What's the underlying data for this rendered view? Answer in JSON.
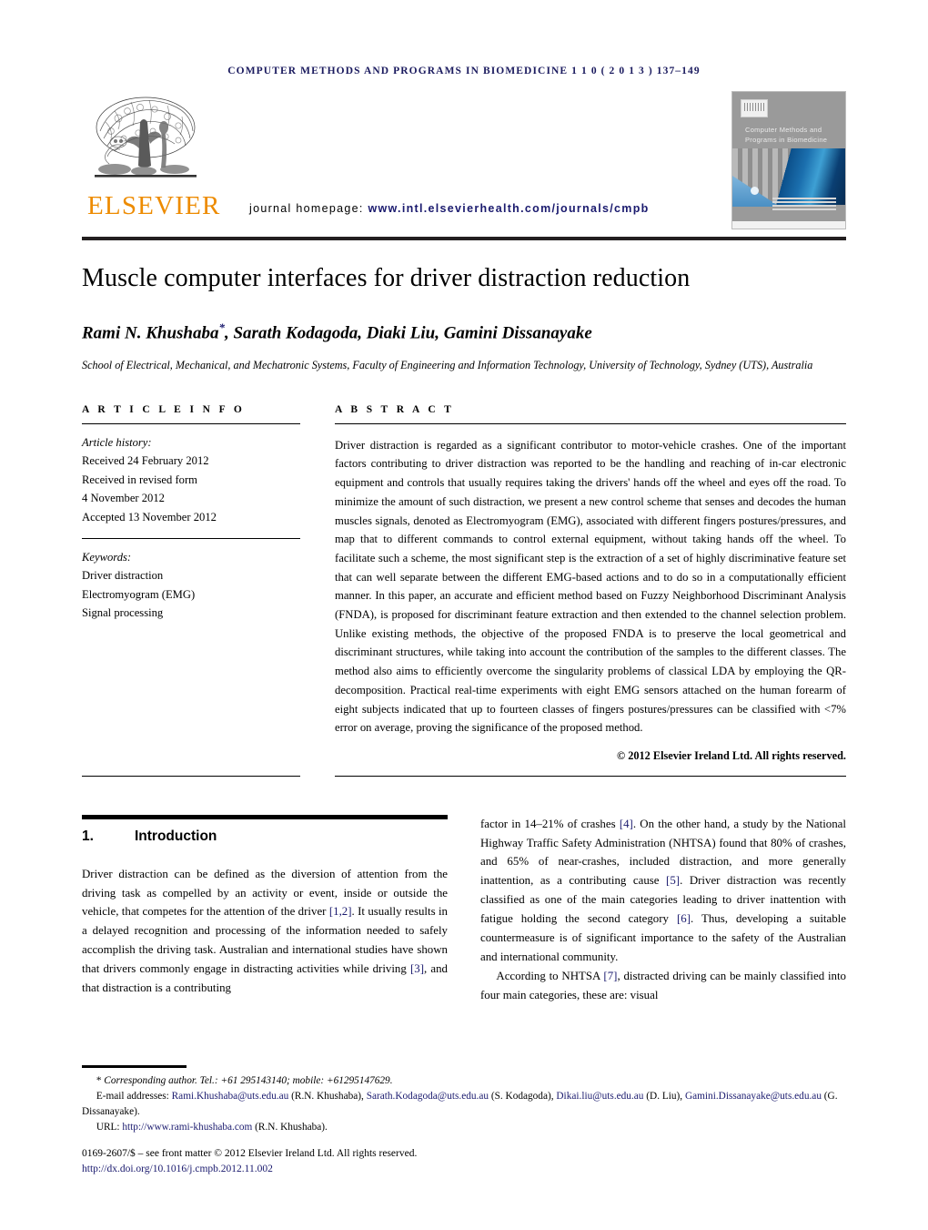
{
  "running_head": "Computer methods and programs in biomedicine 1 1 0 ( 2 0 1 3 ) 137–149",
  "masthead": {
    "publisher_wordmark": "ELSEVIER",
    "publisher_logo_icon": "elsevier-tree-icon",
    "homepage_label": "journal homepage:",
    "homepage_url": "www.intl.elsevierhealth.com/journals/cmpb",
    "cover": {
      "title": "Computer Methods and Programs in Biomedicine",
      "publisher_mark_icon": "elsevier-mark-icon"
    }
  },
  "title": "Muscle computer interfaces for driver distraction reduction",
  "authors": "Rami N. Khushaba, Sarath Kodagoda, Diaki Liu, Gamini Dissanayake",
  "author_marker": "*",
  "affiliation": "School of Electrical, Mechanical, and Mechatronic Systems, Faculty of Engineering and Information Technology, University of Technology, Sydney (UTS), Australia",
  "article_info": {
    "heading": "A R T I C L E   I N F O",
    "history_label": "Article history:",
    "history": [
      "Received 24 February 2012",
      "Received in revised form",
      "4 November 2012",
      "Accepted 13 November 2012"
    ],
    "keywords_label": "Keywords:",
    "keywords": [
      "Driver distraction",
      "Electromyogram (EMG)",
      "Signal processing"
    ]
  },
  "abstract": {
    "heading": "A B S T R A C T",
    "text": "Driver distraction is regarded as a significant contributor to motor-vehicle crashes. One of the important factors contributing to driver distraction was reported to be the handling and reaching of in-car electronic equipment and controls that usually requires taking the drivers' hands off the wheel and eyes off the road. To minimize the amount of such distraction, we present a new control scheme that senses and decodes the human muscles signals, denoted as Electromyogram (EMG), associated with different fingers postures/pressures, and map that to different commands to control external equipment, without taking hands off the wheel. To facilitate such a scheme, the most significant step is the extraction of a set of highly discriminative feature set that can well separate between the different EMG-based actions and to do so in a computationally efficient manner. In this paper, an accurate and efficient method based on Fuzzy Neighborhood Discriminant Analysis (FNDA), is proposed for discriminant feature extraction and then extended to the channel selection problem. Unlike existing methods, the objective of the proposed FNDA is to preserve the local geometrical and discriminant structures, while taking into account the contribution of the samples to the different classes. The method also aims to efficiently overcome the singularity problems of classical LDA by employing the QR-decomposition. Practical real-time experiments with eight EMG sensors attached on the human forearm of eight subjects indicated that up to fourteen classes of fingers postures/pressures can be classified with <7% error on average, proving the significance of the proposed method.",
    "copyright": "© 2012 Elsevier Ireland Ltd. All rights reserved."
  },
  "introduction": {
    "number": "1.",
    "heading": "Introduction",
    "para1_pre": "Driver distraction can be defined as the diversion of attention from the driving task as compelled by an activity or event, inside or outside the vehicle, that competes for the attention of the driver ",
    "ref_12": "[1,2]",
    "para1_mid": ". It usually results in a delayed recognition and processing of the information needed to safely accomplish the driving task. Australian and international studies have shown that drivers commonly engage in distracting activities while driving ",
    "ref_3": "[3]",
    "para1_post": ", and that distraction is a contributing factor in 14–21% of crashes ",
    "ref_4": "[4]",
    "para1_b": ". On the other hand, a study by the National Highway Traffic Safety Administration (NHTSA) found that 80% of crashes, and 65% of near-crashes, included distraction, and more generally inattention, as a contributing cause ",
    "ref_5": "[5]",
    "para1_c": ". Driver distraction was recently classified as one of the main categories leading to driver inattention with fatigue holding the second category ",
    "ref_6": "[6]",
    "para1_d": ". Thus, developing a suitable countermeasure is of significant importance to the safety of the Australian and international community.",
    "para2_pre": "According to NHTSA ",
    "ref_7": "[7]",
    "para2_post": ", distracted driving can be mainly classified into four main categories, these are: visual"
  },
  "footnotes": {
    "corresponding": "Corresponding author. Tel.: +61 295143140; mobile: +61295147629.",
    "corresponding_marker": "*",
    "email_label": "E-mail addresses:",
    "emails": [
      {
        "address": "Rami.Khushaba@uts.edu.au",
        "name": "(R.N. Khushaba),"
      },
      {
        "address": "Sarath.Kodagoda@uts.edu.au",
        "name": "(S. Kodagoda),"
      },
      {
        "address": "Dikai.liu@uts.edu.au",
        "name": "(D. Liu),"
      },
      {
        "address": "Gamini.Dissanayake@uts.edu.au",
        "name": "(G. Dissanayake)."
      }
    ],
    "url_label": "URL:",
    "url": "http://www.rami-khushaba.com",
    "url_owner": "(R.N. Khushaba).",
    "issn_line": "0169-2607/$ – see front matter © 2012 Elsevier Ireland Ltd. All rights reserved.",
    "doi": "http://dx.doi.org/10.1016/j.cmpb.2012.11.002"
  },
  "colors": {
    "link": "#1a1a6e",
    "elsevier_orange": "#ED8B00",
    "rule": "#231f20"
  }
}
